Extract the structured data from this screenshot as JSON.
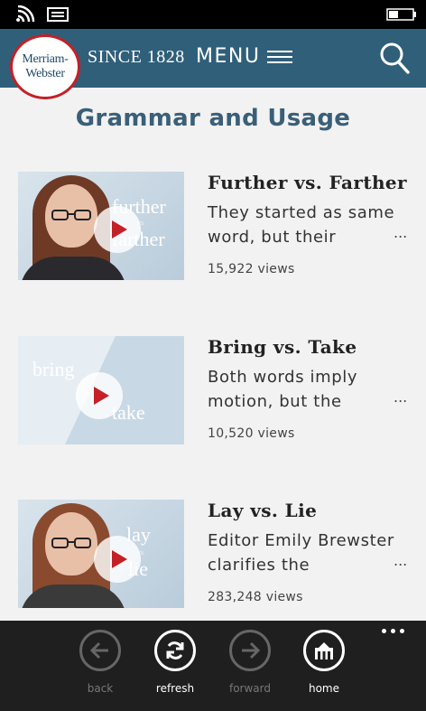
{
  "status_bar": {
    "icons": [
      "signal-icon",
      "message-icon",
      "battery-icon"
    ]
  },
  "header": {
    "logo_line1": "Merriam-",
    "logo_line2": "Webster",
    "since_text": "SINCE 1828",
    "menu_label": "MENU",
    "search_icon": "search-icon",
    "bg_color": "#305f7a",
    "logo_ring_color": "#c42026"
  },
  "page": {
    "title": "Grammar and Usage"
  },
  "videos": [
    {
      "thumb_word_top": "further",
      "thumb_vs": "vs",
      "thumb_word_bottom": "farther",
      "title": "Further vs. Farther",
      "desc_line1": "They started as same",
      "desc_line2": "word, but their",
      "ellipsis": "...",
      "views": "15,922 views"
    },
    {
      "thumb_word_top": "bring",
      "thumb_word_bottom": "take",
      "title": "Bring vs. Take",
      "desc_line1": "Both words imply",
      "desc_line2": "motion, but the",
      "ellipsis": "...",
      "views": "10,520 views"
    },
    {
      "thumb_word_top": "lay",
      "thumb_vs": "vs",
      "thumb_word_bottom": "lie",
      "title": "Lay vs. Lie",
      "desc_line1": "Editor Emily Brewster",
      "desc_line2": "clarifies the",
      "ellipsis": "...",
      "views": "283,248 views"
    }
  ],
  "app_bar": {
    "back_label": "back",
    "refresh_label": "refresh",
    "forward_label": "forward",
    "home_label": "home",
    "more_icon": "more-icon"
  }
}
